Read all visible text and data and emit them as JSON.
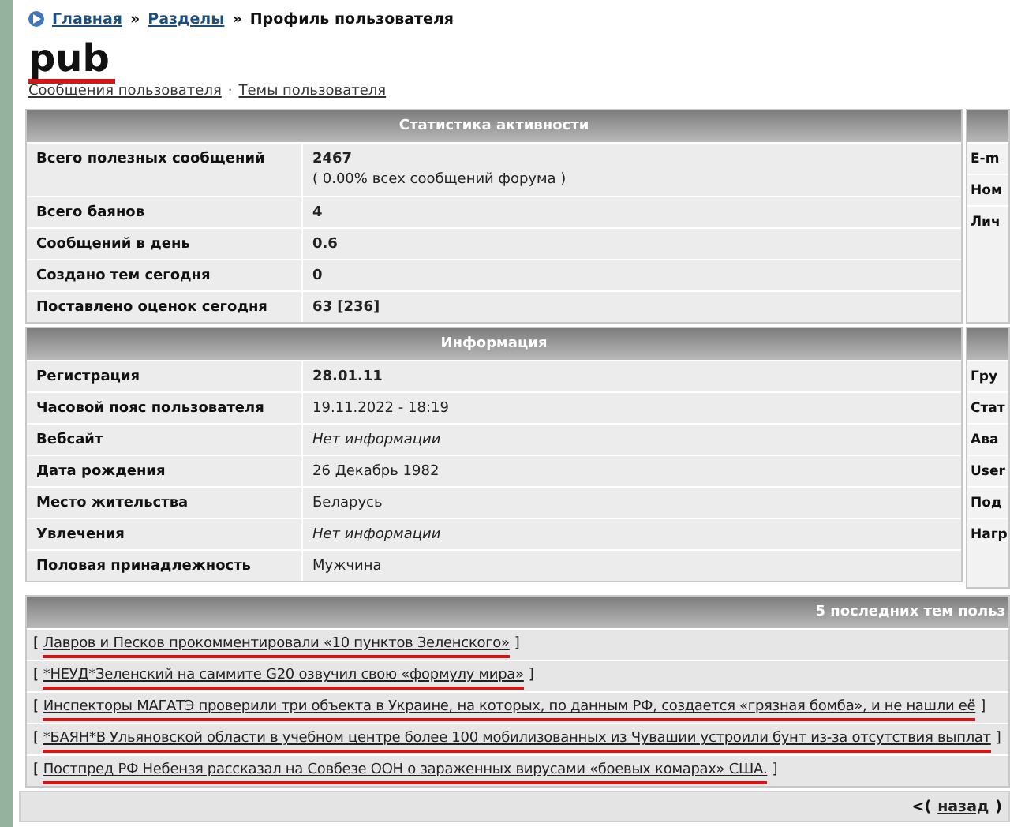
{
  "breadcrumb": {
    "links": [
      "Главная",
      "Разделы"
    ],
    "separator": "»",
    "current": "Профиль пользователя"
  },
  "profile": {
    "name": "pub",
    "marked": true,
    "links": [
      "Сообщения пользователя",
      "Темы пользователя"
    ],
    "link_separator": "·"
  },
  "stats": {
    "title": "Статистика активности",
    "rows": [
      {
        "label": "Всего полезных сообщений",
        "value": "2467",
        "note": "( 0.00% всех сообщений форума )",
        "bold": true
      },
      {
        "label": "Всего баянов",
        "value": "4",
        "bold": true
      },
      {
        "label": "Сообщений в день",
        "value": "0.6",
        "bold": true
      },
      {
        "label": "Создано тем сегодня",
        "value": "0",
        "bold": true
      },
      {
        "label": "Поставлено оценок сегодня",
        "value": "63 [236]",
        "bold": true
      }
    ]
  },
  "contacts": {
    "rows": [
      "E-m",
      "Ном",
      "Лич"
    ]
  },
  "info": {
    "title": "Информация",
    "rows": [
      {
        "label": "Регистрация",
        "value": "28.01.11",
        "bold": true,
        "italic": false
      },
      {
        "label": "Часовой пояс пользователя",
        "value": "19.11.2022 - 18:19",
        "bold": false,
        "italic": false
      },
      {
        "label": "Вебсайт",
        "value": "Нет информации",
        "bold": false,
        "italic": true
      },
      {
        "label": "Дата рождения",
        "value": "26 Декабрь 1982",
        "bold": false,
        "italic": false
      },
      {
        "label": "Место жительства",
        "value": "Беларусь",
        "bold": false,
        "italic": false
      },
      {
        "label": "Увлечения",
        "value": "Нет информации",
        "bold": false,
        "italic": true
      },
      {
        "label": "Половая принадлежность",
        "value": "Мужчина",
        "bold": false,
        "italic": false
      }
    ]
  },
  "extra": {
    "rows": [
      "Гру",
      "Стат",
      "Ава",
      "User",
      "Под",
      "Нагр"
    ]
  },
  "topics": {
    "title": "5 последних тем польз",
    "open": "[",
    "close": "]",
    "items": [
      {
        "title": "Лавров и Песков прокомментировали «10 пунктов Зеленского»",
        "marked": true
      },
      {
        "title": "*НЕУД*Зеленский на саммите G20 озвучил свою «формулу мира»",
        "marked": true
      },
      {
        "title": "Инспекторы МАГАТЭ проверили три объекта в Украине, на которых, по данным РФ, создается «грязная бомба», и не нашли её",
        "marked": true
      },
      {
        "title": "*БАЯН*В Ульяновской области в учебном центре более 100 мобилизованных из Чувашии устроили бунт из-за отсутствия выплат",
        "marked": true
      },
      {
        "title": "Постпред РФ Небензя рассказал на Совбезе ООН о зараженных вирусами «боевых комарах» США.",
        "marked": true
      }
    ]
  },
  "footer": {
    "prefix": "<(",
    "link": "назад",
    "suffix": ")"
  }
}
